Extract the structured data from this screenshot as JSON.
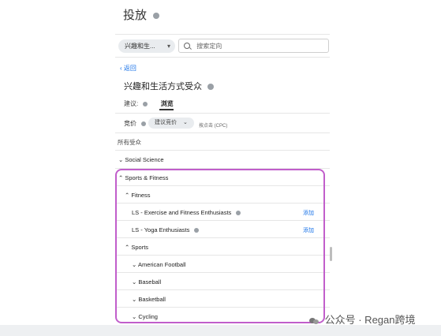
{
  "header": {
    "title": "投放"
  },
  "filter": {
    "chip_label": "兴趣和生...",
    "search_placeholder": "搜索定向"
  },
  "nav": {
    "back_label": "返回"
  },
  "section": {
    "title": "兴趣和生活方式受众"
  },
  "tabs": {
    "suggest_label": "建议:",
    "browse_label": "浏览"
  },
  "bid": {
    "label": "竞价",
    "pill_label": "建议竞价",
    "note": "按点击 (CPC)"
  },
  "audience": {
    "all_label": "所有受众"
  },
  "tree": [
    {
      "label": "Social Science",
      "add": ""
    },
    {
      "label": "Sports & Fitness",
      "add": ""
    },
    {
      "label": "Fitness",
      "add": ""
    },
    {
      "label": "LS - Exercise and Fitness Enthusiasts",
      "add": "添加"
    },
    {
      "label": "LS - Yoga Enthusiasts",
      "add": "添加"
    },
    {
      "label": "Sports",
      "add": ""
    },
    {
      "label": "American Football",
      "add": ""
    },
    {
      "label": "Baseball",
      "add": ""
    },
    {
      "label": "Basketball",
      "add": ""
    },
    {
      "label": "Cycling",
      "add": ""
    }
  ],
  "watermark": {
    "text": "公众号 · Regan跨境"
  }
}
